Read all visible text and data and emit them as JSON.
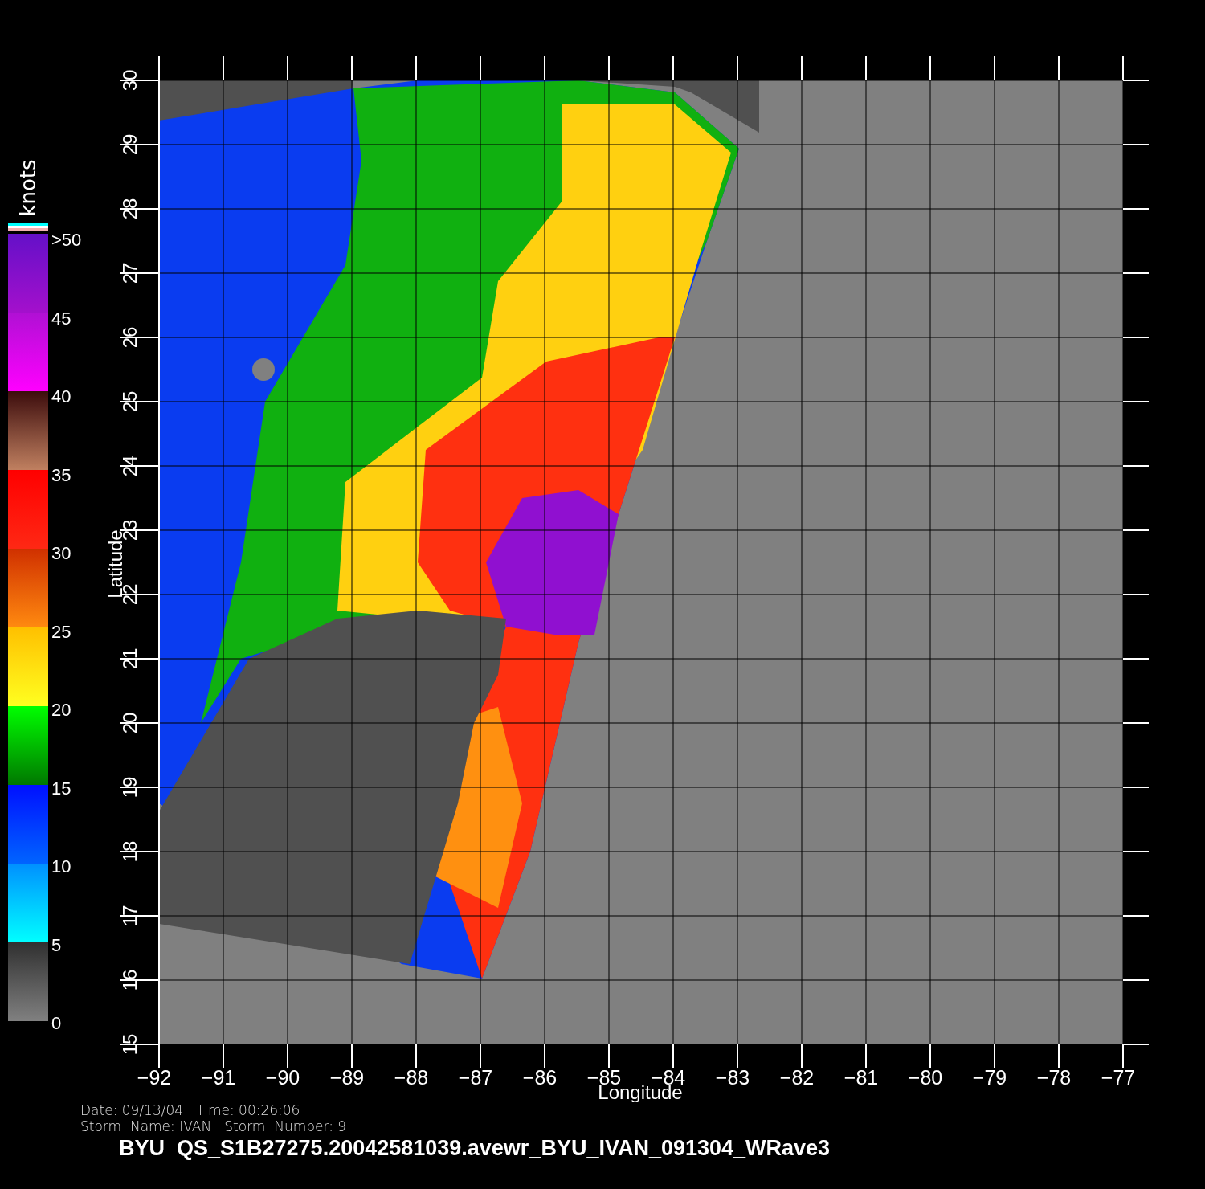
{
  "colorbar": {
    "unit": "knots",
    "labels": [
      ">50",
      "45",
      "40",
      "35",
      "30",
      "25",
      "20",
      "15",
      "10",
      "5",
      "0"
    ]
  },
  "map": {
    "y_axis_label": "Latitude",
    "x_axis_label": "Longitude",
    "y_ticks": [
      "30",
      "29",
      "28",
      "27",
      "26",
      "25",
      "24",
      "23",
      "22",
      "21",
      "20",
      "19",
      "18",
      "17",
      "16",
      "15"
    ],
    "x_ticks": [
      "−92",
      "−91",
      "−90",
      "−89",
      "−88",
      "−87",
      "−86",
      "−85",
      "−84",
      "−83",
      "−82",
      "−81",
      "−80",
      "−79",
      "−78",
      "−77"
    ]
  },
  "footer": {
    "info_lines": [
      "Date: 09/13/04   Time: 00:26:06",
      "Storm  Name: IVAN   Storm  Number: 9"
    ],
    "title": "BYU  QS_S1B27275.20042581039.avewr_BYU_IVAN_091304_WRave3"
  }
}
